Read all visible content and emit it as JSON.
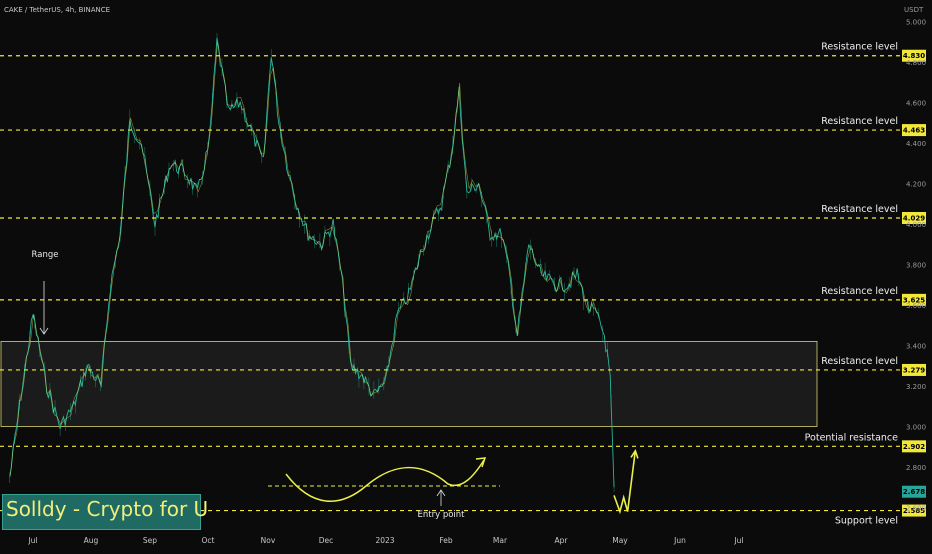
{
  "header": {
    "symbol": "CAKE / TetherUS, 4h, BINANCE",
    "currency": "USDT"
  },
  "watermark": "Solldy - Crypto for U",
  "colors": {
    "background": "#0b0b0b",
    "price_line": "#2ab39b",
    "highlight": "#e9f04a",
    "level_line": "#f2e83a",
    "range_box_fill": "#2a2a2a",
    "range_box_border": "#d7d36a"
  },
  "current_price": "2.678",
  "annotations": {
    "range": "Range",
    "entry_point": "Entry point"
  },
  "chart_data": {
    "type": "line",
    "title": "CAKE / TetherUS, 4h, BINANCE",
    "xlabel": "",
    "ylabel": "USDT",
    "ylim": [
      2.53,
      5.1
    ],
    "x_ticks": [
      "Jul",
      "Aug",
      "Sep",
      "Oct",
      "Nov",
      "Dec",
      "2023",
      "Feb",
      "Mar",
      "Apr",
      "May",
      "Jun",
      "Jul"
    ],
    "y_ticks": [
      "5.000",
      "4.800",
      "4.600",
      "4.400",
      "4.200",
      "4.000",
      "3.800",
      "3.600",
      "3.400",
      "3.200",
      "3.000",
      "2.800",
      "2.600"
    ],
    "grid": false,
    "series": [
      {
        "x": [
          "Jun 19",
          "Jun 24",
          "Jul 1",
          "Jul 8",
          "Jul 15",
          "Jul 22",
          "Jul 29",
          "Aug 5",
          "Aug 10",
          "Aug 15",
          "Aug 20",
          "Aug 26",
          "Sep 2",
          "Sep 10",
          "Sep 18",
          "Sep 24",
          "Sep 30",
          "Oct 4",
          "Oct 10",
          "Oct 16",
          "Oct 22",
          "Oct 28",
          "Nov 1",
          "Nov 5",
          "Nov 9",
          "Nov 14",
          "Nov 20",
          "Nov 27",
          "Dec 3",
          "Dec 8",
          "Dec 12",
          "Dec 18",
          "Dec 24",
          "Dec 30",
          "Jan 5",
          "Jan 11",
          "Jan 17",
          "Jan 23",
          "Jan 28",
          "Feb 2",
          "Feb 6",
          "Feb 10",
          "Feb 16",
          "Feb 22",
          "Feb 28",
          "Mar 4",
          "Mar 8",
          "Mar 14",
          "Mar 20",
          "Mar 28",
          "Apr 3",
          "Apr 8",
          "Apr 13",
          "Apr 18",
          "Apr 22",
          "Apr 25",
          "Apr 27"
        ],
        "y": [
          2.75,
          3.1,
          3.55,
          3.2,
          3.0,
          3.1,
          3.3,
          3.2,
          3.7,
          3.95,
          4.5,
          4.4,
          4.0,
          4.3,
          4.25,
          4.15,
          4.4,
          4.9,
          4.55,
          4.6,
          4.45,
          4.3,
          4.85,
          4.5,
          4.3,
          4.1,
          3.95,
          3.9,
          4.0,
          3.7,
          3.3,
          3.25,
          3.15,
          3.22,
          3.55,
          3.65,
          3.85,
          4.0,
          4.1,
          4.35,
          4.65,
          4.15,
          4.2,
          3.95,
          3.95,
          3.75,
          3.45,
          3.9,
          3.75,
          3.7,
          3.7,
          3.75,
          3.6,
          3.55,
          3.45,
          3.25,
          2.7
        ]
      },
      {
        "x": [
          "Apr 27",
          "Apr 30",
          "May 2",
          "May 4",
          "May 8"
        ],
        "y": [
          2.66,
          2.58,
          2.65,
          2.58,
          2.88
        ]
      }
    ],
    "levels": [
      {
        "label": "Resistance level",
        "value": 4.83,
        "badge": "4.830"
      },
      {
        "label": "Resistance level",
        "value": 4.463,
        "badge": "4.463"
      },
      {
        "label": "Resistance level",
        "value": 4.029,
        "badge": "4.029"
      },
      {
        "label": "Resistance level",
        "value": 3.625,
        "badge": "3.625"
      },
      {
        "label": "Resistance level",
        "value": 3.279,
        "badge": "3.279"
      },
      {
        "label": "Potential resistance",
        "value": 2.902,
        "badge": "2.902"
      },
      {
        "label": "Support level",
        "value": 2.585,
        "badge": "2.585"
      }
    ],
    "range_box": {
      "y_low": 3.0,
      "y_high": 3.42
    }
  }
}
